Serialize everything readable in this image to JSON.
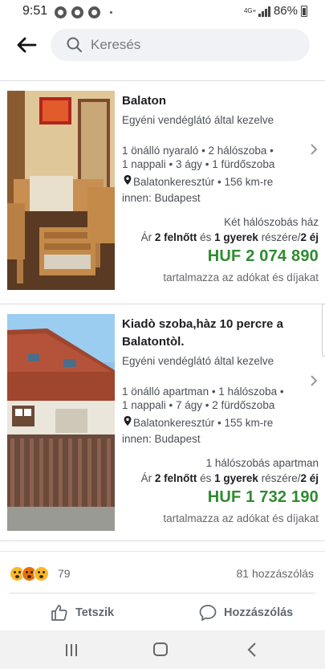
{
  "status_bar": {
    "time": "9:51",
    "network": "4G+",
    "battery": "86%"
  },
  "search": {
    "placeholder": "Keresés"
  },
  "listings": [
    {
      "title": "Balaton",
      "host": "Egyéni vendéglátó által kezelve",
      "features_line1": "1 önálló nyaraló • 2 hálószoba •",
      "features_line2": "1 nappali • 3 ágy • 1 fürdőszoba",
      "location": "Balatonkeresztúr • 156 km-re",
      "from": "innen: Budapest",
      "room_type": "Két hálószobás ház",
      "guests_prefix": "Ár ",
      "adults": "2 felnőtt",
      "guests_mid": " és ",
      "children": "1 gyerek",
      "guests_mid2": " részére/",
      "nights": "2 éj",
      "price": "HUF 2 074 890",
      "tax_note": "tartalmazza az adókat és díjakat"
    },
    {
      "title": "Kiadò szoba,hàz 10 percre a Balatontòl.",
      "host": "Egyéni vendéglátó által kezelve",
      "features_line1": "1 önálló apartman • 1 hálószoba •",
      "features_line2": "1 nappali • 7 ágy • 2 fürdőszoba",
      "location": "Balatonkeresztúr • 155 km-re",
      "from": "innen: Budapest",
      "room_type": "1 hálószobás apartman",
      "guests_prefix": "Ár ",
      "adults": "2 felnőtt",
      "guests_mid": " és ",
      "children": "1 gyerek",
      "guests_mid2": " részére/",
      "nights": "2 éj",
      "price": "HUF 1 732 190",
      "tax_note": "tartalmazza az adókat és díjakat"
    }
  ],
  "post_footer": {
    "reaction_count": "79",
    "comment_count": "81 hozzászólás",
    "like_label": "Tetszik",
    "comment_label": "Hozzászólás"
  },
  "colors": {
    "price_green": "#2e8b2e",
    "action_grey": "#606770"
  }
}
